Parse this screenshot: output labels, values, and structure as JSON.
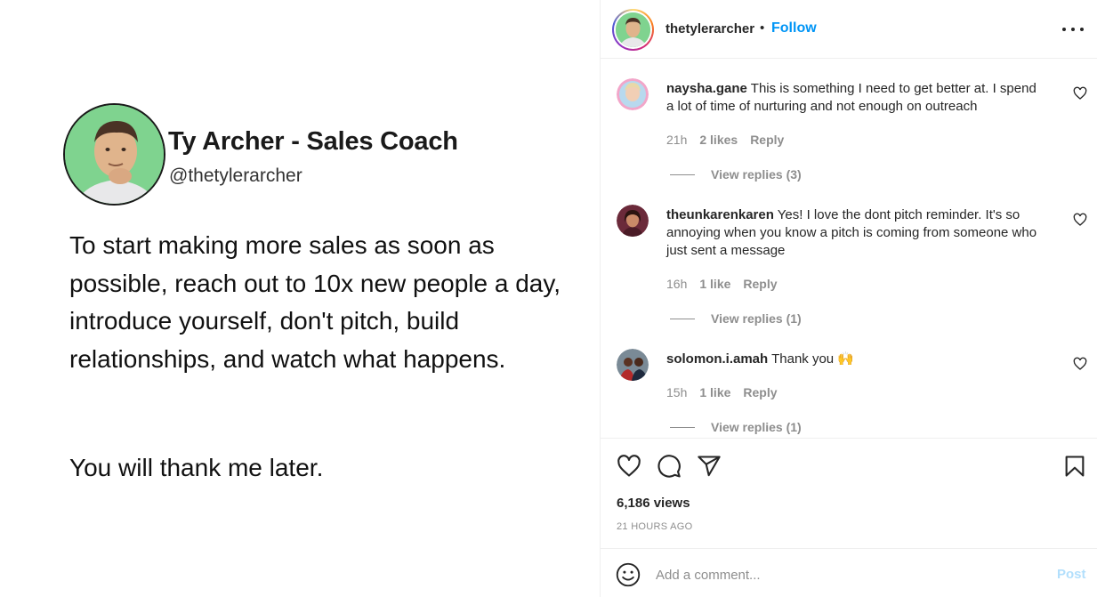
{
  "post_image": {
    "name": "Ty Archer - Sales Coach",
    "handle": "@thetylerarcher",
    "body": "To start making more sales as soon as possible, reach out to 10x new people a day, introduce yourself, don't pitch, build relationships, and watch what happens.",
    "closing": "You will thank me later."
  },
  "header": {
    "username": "thetylerarcher",
    "separator": "•",
    "follow_label": "Follow"
  },
  "comments": [
    {
      "username": "naysha.gane",
      "text": "This is something I need to get better at. I spend a lot of time of nurturing and not enough on outreach",
      "time": "21h",
      "likes": "2 likes",
      "reply_label": "Reply",
      "view_replies": "View replies (3)"
    },
    {
      "username": "theunkarenkaren",
      "text": "Yes! I love the dont pitch reminder. It's so annoying when you know a pitch is coming from someone who just sent a message",
      "time": "16h",
      "likes": "1 like",
      "reply_label": "Reply",
      "view_replies": "View replies (1)"
    },
    {
      "username": "solomon.i.amah",
      "text": "Thank you 🙌",
      "time": "15h",
      "likes": "1 like",
      "reply_label": "Reply",
      "view_replies": "View replies (1)"
    }
  ],
  "actions": {
    "icons": [
      "heart-icon",
      "comment-icon",
      "share-icon",
      "bookmark-icon"
    ],
    "views": "6,186 views",
    "time_ago": "21 HOURS AGO"
  },
  "add_comment": {
    "placeholder": "Add a comment...",
    "post_label": "Post"
  },
  "colors": {
    "follow_blue": "#0095f6",
    "post_disabled": "#b2dffc",
    "muted_text": "#8e8e8e"
  }
}
